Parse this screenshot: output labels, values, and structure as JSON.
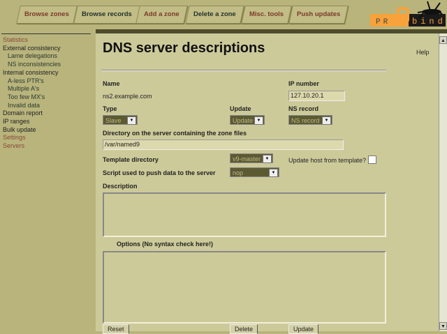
{
  "nav": {
    "tabs": [
      "Browse zones",
      "Browse records",
      "Add a zone",
      "Delete a zone",
      "Misc. tools",
      "Push updates"
    ]
  },
  "logo": {
    "text_left": "PRO",
    "text_right": "bind"
  },
  "sidebar": {
    "items": [
      {
        "label": "Statistics"
      },
      {
        "label": "External consistency"
      },
      {
        "label": "Lame delegations"
      },
      {
        "label": "NS inconsistencies"
      },
      {
        "label": "Internal consistency"
      },
      {
        "label": "A-less PTR's"
      },
      {
        "label": "Multiple A's"
      },
      {
        "label": "Too few MX's"
      },
      {
        "label": "Invalid data"
      },
      {
        "label": "Domain report"
      },
      {
        "label": "IP ranges"
      },
      {
        "label": "Bulk update"
      },
      {
        "label": "Settings"
      },
      {
        "label": "Servers"
      }
    ]
  },
  "page": {
    "title": "DNS server descriptions",
    "help": "Help"
  },
  "form": {
    "name_label": "Name",
    "name_value": "ns2.example.com",
    "ip_label": "IP number",
    "ip_value": "127.10.20.1",
    "type_label": "Type",
    "type_value": "Slave",
    "update_label": "Update",
    "update_value": "Update",
    "ns_label": "NS record",
    "ns_value": "NS record",
    "dir_label": "Directory on the server containing the zone files",
    "dir_value": "/var/named9",
    "template_label": "Template directory",
    "template_value": "v9-master",
    "update_host_label": "Update host from template?",
    "script_label": "Script used to push data to the server",
    "script_value": "nop",
    "description_label": "Description",
    "options_label": "Options (No syntax check here!)",
    "reset": "Reset",
    "delete": "Delete",
    "update": "Update"
  }
}
